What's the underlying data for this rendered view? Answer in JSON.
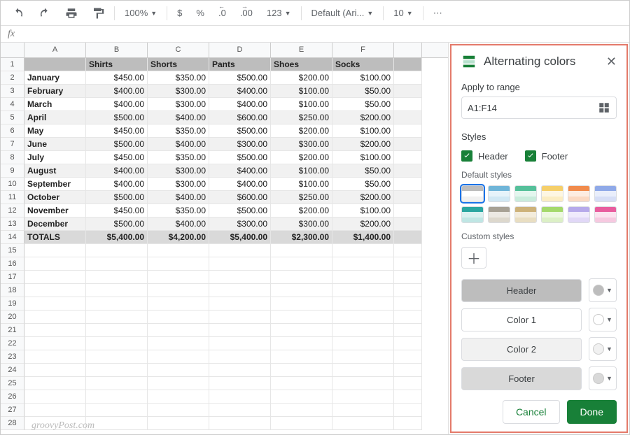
{
  "toolbar": {
    "zoom": "100%",
    "currency": "$",
    "percent": "%",
    "dec_dec": ".0",
    "inc_dec": ".00",
    "more_fmt": "123",
    "font": "Default (Ari...",
    "font_size": "10",
    "more": "⋯"
  },
  "fx": "fx",
  "columns": [
    "A",
    "B",
    "C",
    "D",
    "E",
    "F"
  ],
  "header_row": [
    "",
    "Shirts",
    "Shorts",
    "Pants",
    "Shoes",
    "Socks"
  ],
  "rows": [
    {
      "label": "January",
      "vals": [
        "$450.00",
        "$350.00",
        "$500.00",
        "$200.00",
        "$100.00"
      ]
    },
    {
      "label": "February",
      "vals": [
        "$400.00",
        "$300.00",
        "$400.00",
        "$100.00",
        "$50.00"
      ]
    },
    {
      "label": "March",
      "vals": [
        "$400.00",
        "$300.00",
        "$400.00",
        "$100.00",
        "$50.00"
      ]
    },
    {
      "label": "April",
      "vals": [
        "$500.00",
        "$400.00",
        "$600.00",
        "$250.00",
        "$200.00"
      ]
    },
    {
      "label": "May",
      "vals": [
        "$450.00",
        "$350.00",
        "$500.00",
        "$200.00",
        "$100.00"
      ]
    },
    {
      "label": "June",
      "vals": [
        "$500.00",
        "$400.00",
        "$300.00",
        "$300.00",
        "$200.00"
      ]
    },
    {
      "label": "July",
      "vals": [
        "$450.00",
        "$350.00",
        "$500.00",
        "$200.00",
        "$100.00"
      ]
    },
    {
      "label": "August",
      "vals": [
        "$400.00",
        "$300.00",
        "$400.00",
        "$100.00",
        "$50.00"
      ]
    },
    {
      "label": "September",
      "vals": [
        "$400.00",
        "$300.00",
        "$400.00",
        "$100.00",
        "$50.00"
      ]
    },
    {
      "label": "October",
      "vals": [
        "$500.00",
        "$400.00",
        "$600.00",
        "$250.00",
        "$200.00"
      ]
    },
    {
      "label": "November",
      "vals": [
        "$450.00",
        "$350.00",
        "$500.00",
        "$200.00",
        "$100.00"
      ]
    },
    {
      "label": "December",
      "vals": [
        "$500.00",
        "$400.00",
        "$300.00",
        "$300.00",
        "$200.00"
      ]
    }
  ],
  "totals": {
    "label": "TOTALS",
    "vals": [
      "$5,400.00",
      "$4,200.00",
      "$5,400.00",
      "$2,300.00",
      "$1,400.00"
    ]
  },
  "empty_row_count": 14,
  "panel": {
    "title": "Alternating colors",
    "range_label": "Apply to range",
    "range_value": "A1:F14",
    "styles_label": "Styles",
    "chk_header": "Header",
    "chk_footer": "Footer",
    "default_styles_label": "Default styles",
    "custom_styles_label": "Custom styles",
    "row_header": "Header",
    "row_color1": "Color 1",
    "row_color2": "Color 2",
    "row_footer": "Footer",
    "cancel": "Cancel",
    "done": "Done",
    "swatch_palettes": [
      [
        "#bdbdbd",
        "#ffffff",
        "#f1f1f1"
      ],
      [
        "#6fb5d8",
        "#e6f3fa",
        "#d1e8f4"
      ],
      [
        "#55c09a",
        "#e3f6ee",
        "#c9ecdc"
      ],
      [
        "#f5cf6a",
        "#fdf6e2",
        "#fbedc3"
      ],
      [
        "#f18b4c",
        "#fdece1",
        "#fbd9c3"
      ],
      [
        "#8fa9e8",
        "#e9eefb",
        "#d6def6"
      ],
      [
        "#2aa6a0",
        "#d9f1f0",
        "#bfe6e4"
      ],
      [
        "#a7a195",
        "#ece9e3",
        "#ddd8cd"
      ],
      [
        "#cdb27a",
        "#f3ecdc",
        "#e9dec2"
      ],
      [
        "#a4d96c",
        "#edf8e0",
        "#dcf0c6"
      ],
      [
        "#b6a9ea",
        "#efeafc",
        "#e1d8f7"
      ],
      [
        "#e85d9e",
        "#fbe3ef",
        "#f6c9e0"
      ]
    ],
    "color_dots": [
      "#bdbdbd",
      "#ffffff",
      "#f1f1f1",
      "#d9d9d9"
    ]
  },
  "watermark": "groovyPost.com"
}
